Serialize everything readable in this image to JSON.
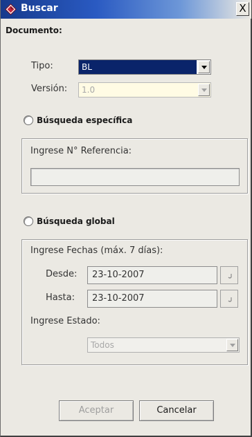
{
  "window": {
    "title": "Buscar",
    "close_symbol": "X",
    "icons": {
      "app": "diamond-app-icon",
      "close": "close-icon",
      "calendar": "calendar-icon"
    }
  },
  "documento": {
    "title": "Documento:",
    "tipo_label": "Tipo:",
    "tipo_value": "BL",
    "version_label": "Versión:",
    "version_value": "1.0"
  },
  "especifica": {
    "radio_label": "Búsqueda específica",
    "group_label": "Ingrese N° Referencia:",
    "referencia_value": ""
  },
  "global": {
    "radio_label": "Búsqueda global",
    "fechas_label": "Ingrese Fechas (máx. 7 días):",
    "desde_label": "Desde:",
    "desde_value": "23-10-2007",
    "hasta_label": "Hasta:",
    "hasta_value": "23-10-2007",
    "estado_label": "Ingrese Estado:",
    "estado_value": "Todos"
  },
  "buttons": {
    "aceptar": "Aceptar",
    "cancelar": "Cancelar"
  },
  "colors": {
    "title_gradient_start": "#163a8c",
    "selection": "#0a246a",
    "window_bg": "#ebe9e3",
    "app_icon": "#c6283c"
  }
}
